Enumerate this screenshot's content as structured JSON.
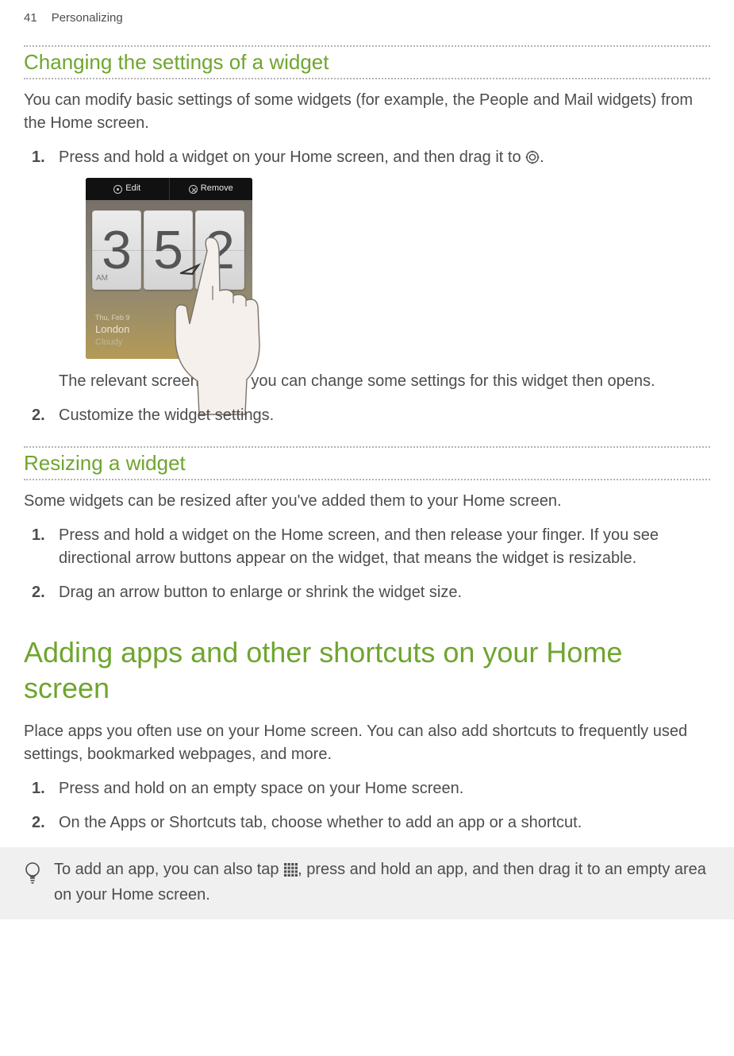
{
  "page": {
    "number": "41",
    "section": "Personalizing"
  },
  "sectionA": {
    "title": "Changing the settings of a widget",
    "intro": "You can modify basic settings of some widgets (for example, the People and Mail widgets) from the Home screen.",
    "step1_a": "Press and hold a widget on your Home screen, and then drag it to ",
    "step1_b": ".",
    "screenshot": {
      "editLabel": "Edit",
      "removeLabel": "Remove",
      "hour": "3",
      "min1": "5",
      "min2": "2",
      "ampm": "AM",
      "date": "Thu, Feb 9",
      "city": "London",
      "weather": "Cloudy"
    },
    "step1_result": "The relevant screen where you can change some settings for this widget then opens.",
    "step2": "Customize the widget settings."
  },
  "sectionB": {
    "title": "Resizing a widget",
    "intro": "Some widgets can be resized after you've added them to your Home screen.",
    "step1": "Press and hold a widget on the Home screen, and then release your finger. If you see directional arrow buttons appear on the widget, that means the widget is resizable.",
    "step2": "Drag an arrow button to enlarge or shrink the widget size."
  },
  "sectionC": {
    "title": "Adding apps and other shortcuts on your Home screen",
    "intro": "Place apps you often use on your Home screen. You can also add shortcuts to frequently used settings, bookmarked webpages, and more.",
    "step1": "Press and hold on an empty space on your Home screen.",
    "step2": "On the Apps or Shortcuts tab, choose whether to add an app or a shortcut."
  },
  "tip": {
    "text_a": "To add an app, you can also tap ",
    "text_b": ", press and hold an app, and then drag it to an empty area on your Home screen."
  }
}
